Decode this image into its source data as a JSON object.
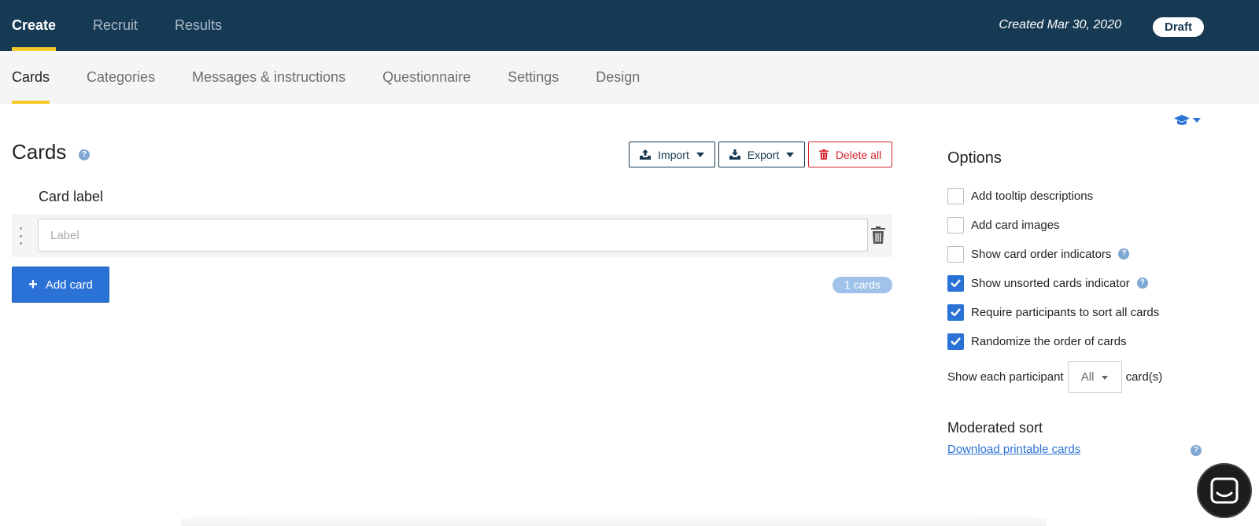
{
  "topnav": {
    "items": [
      {
        "label": "Create",
        "active": true
      },
      {
        "label": "Recruit",
        "active": false
      },
      {
        "label": "Results",
        "active": false
      }
    ],
    "created": "Created Mar 30, 2020",
    "status": "Draft"
  },
  "subnav": {
    "tabs": [
      {
        "label": "Cards",
        "active": true
      },
      {
        "label": "Categories",
        "active": false
      },
      {
        "label": "Messages & instructions",
        "active": false
      },
      {
        "label": "Questionnaire",
        "active": false
      },
      {
        "label": "Settings",
        "active": false
      },
      {
        "label": "Design",
        "active": false
      }
    ]
  },
  "main": {
    "title": "Cards",
    "import_label": "Import",
    "export_label": "Export",
    "delete_all_label": "Delete all",
    "card_label_header": "Card label",
    "label_placeholder": "Label",
    "label_value": "",
    "add_card_label": "Add card",
    "card_count": "1 cards"
  },
  "options": {
    "title": "Options",
    "items": [
      {
        "label": "Add tooltip descriptions",
        "checked": false,
        "help": false
      },
      {
        "label": "Add card images",
        "checked": false,
        "help": false
      },
      {
        "label": "Show card order indicators",
        "checked": false,
        "help": true
      },
      {
        "label": "Show unsorted cards indicator",
        "checked": true,
        "help": true
      },
      {
        "label": "Require participants to sort all cards",
        "checked": true,
        "help": false
      },
      {
        "label": "Randomize the order of cards",
        "checked": true,
        "help": false
      }
    ],
    "show_each_prefix": "Show each participant",
    "show_each_value": "All",
    "show_each_suffix": "card(s)"
  },
  "moderated": {
    "title": "Moderated sort",
    "download_link": "Download printable cards"
  },
  "colors": {
    "topbar_bg": "#173a54",
    "accent_yellow": "#f5c928",
    "primary_blue": "#2a72d6",
    "danger_red": "#d8232a"
  },
  "icons": {
    "import": "upload-icon",
    "export": "download-icon",
    "delete": "trash-icon",
    "help": "question-circle-icon",
    "drag": "drag-handle-icon",
    "add": "plus-icon",
    "tutorial": "graduation-cap-icon",
    "chat": "chat-icon"
  }
}
